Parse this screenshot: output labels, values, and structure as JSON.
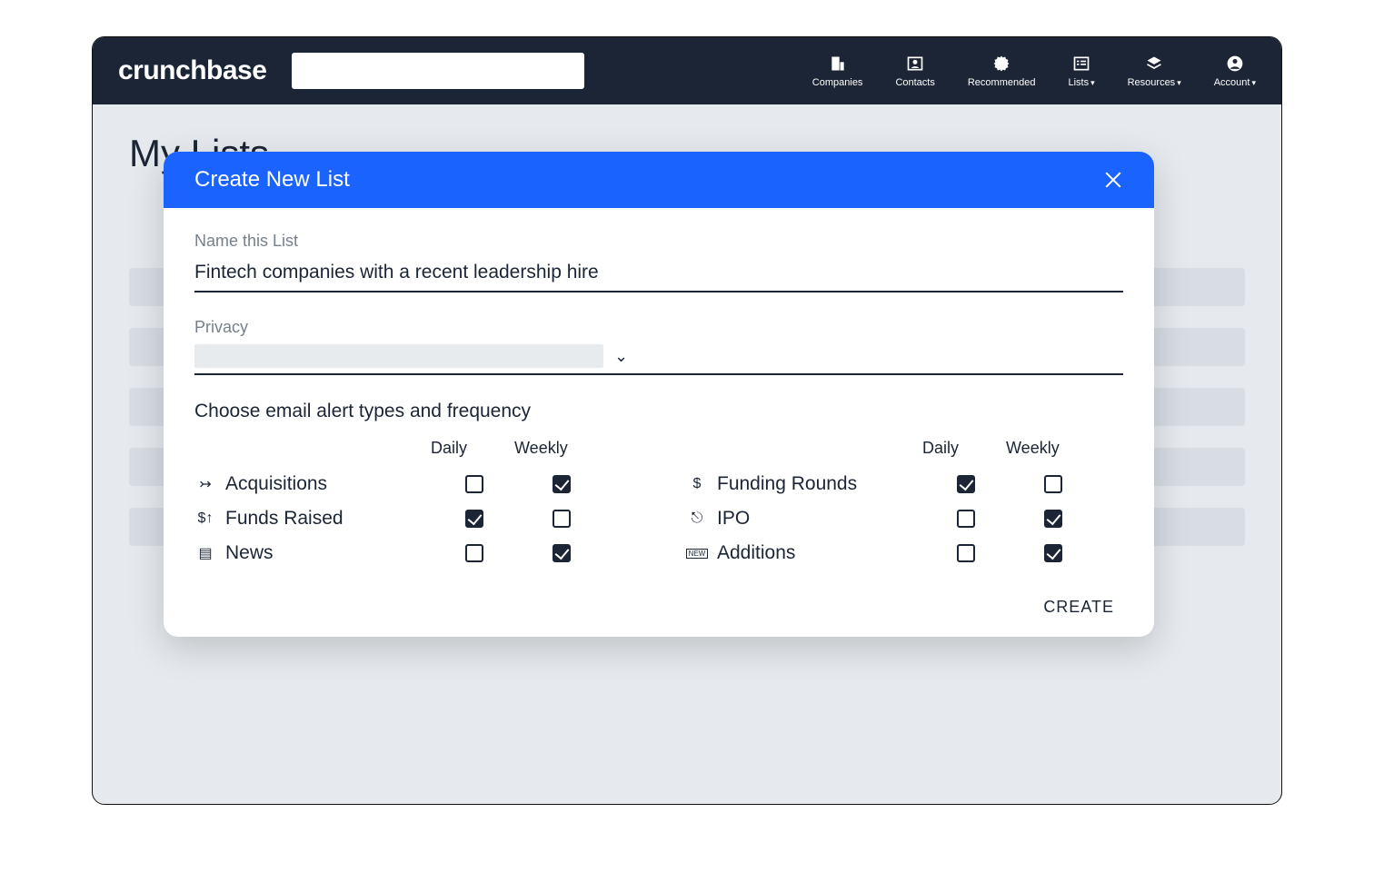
{
  "brand": "crunchbase",
  "nav": {
    "companies": "Companies",
    "contacts": "Contacts",
    "recommended": "Recommended",
    "lists": "Lists",
    "resources": "Resources",
    "account": "Account"
  },
  "page_title": "My Lists",
  "modal": {
    "title": "Create New List",
    "name_label": "Name this List",
    "name_value": "Fintech companies with a recent leadership hire",
    "privacy_label": "Privacy",
    "alerts_title": "Choose email alert types and frequency",
    "col_daily": "Daily",
    "col_weekly": "Weekly",
    "create_label": "CREATE",
    "left_alerts": [
      {
        "label": "Acquisitions",
        "daily": false,
        "weekly": true
      },
      {
        "label": "Funds Raised",
        "daily": true,
        "weekly": false
      },
      {
        "label": "News",
        "daily": false,
        "weekly": true
      }
    ],
    "right_alerts": [
      {
        "label": "Funding Rounds",
        "daily": true,
        "weekly": false
      },
      {
        "label": "IPO",
        "daily": false,
        "weekly": true
      },
      {
        "label": "Additions",
        "daily": false,
        "weekly": true
      }
    ]
  }
}
